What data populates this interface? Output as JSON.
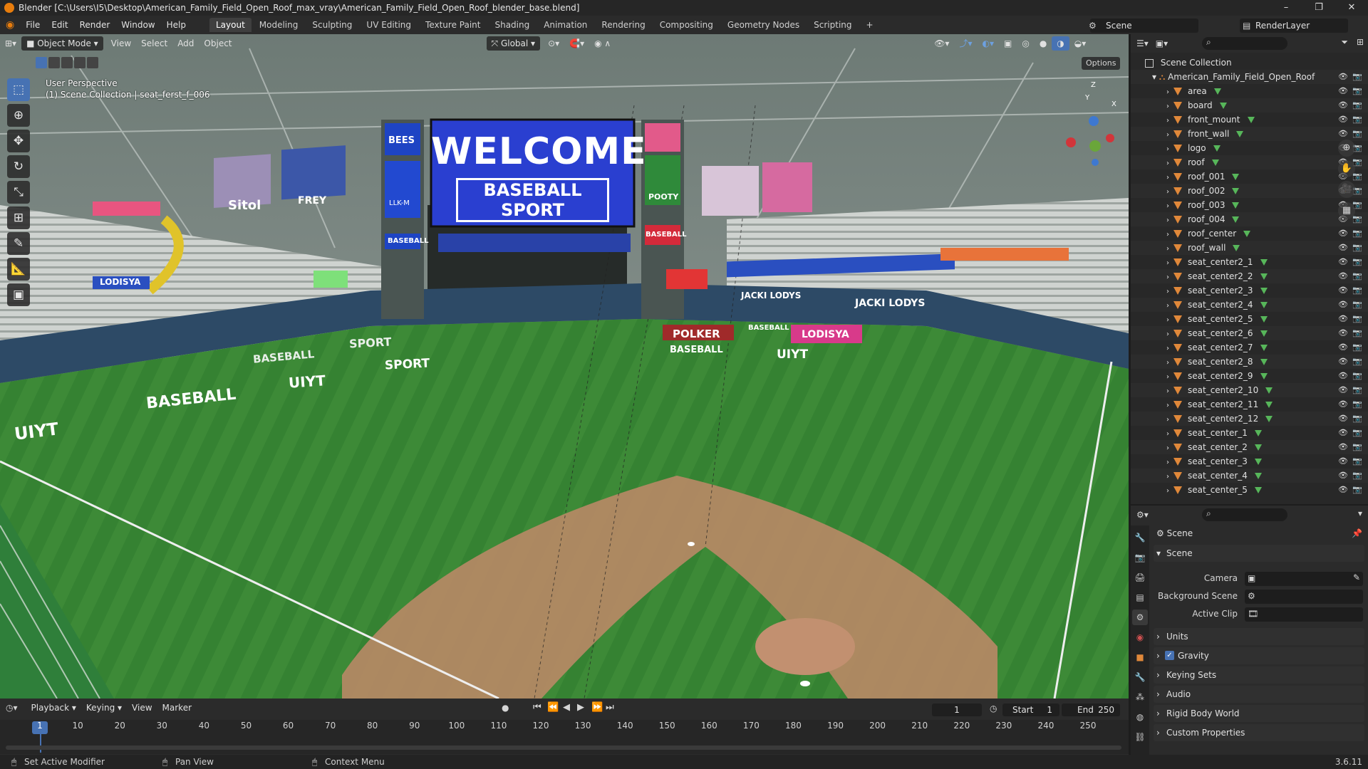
{
  "window": {
    "title": "Blender [C:\\Users\\I5\\Desktop\\American_Family_Field_Open_Roof_max_vray\\American_Family_Field_Open_Roof_blender_base.blend]",
    "minimize": "–",
    "maximize": "❐",
    "close": "✕"
  },
  "menus": [
    "File",
    "Edit",
    "Render",
    "Window",
    "Help"
  ],
  "workspaces": [
    "Layout",
    "Modeling",
    "Sculpting",
    "UV Editing",
    "Texture Paint",
    "Shading",
    "Animation",
    "Rendering",
    "Compositing",
    "Geometry Nodes",
    "Scripting"
  ],
  "workspace_add": "+",
  "scene_name": "Scene",
  "view_layer": "RenderLayer",
  "viewport": {
    "mode": "Object Mode",
    "menus": [
      "View",
      "Select",
      "Add",
      "Object"
    ],
    "transform_orientation": "Global",
    "options": "Options",
    "overlay_line1": "User Perspective",
    "overlay_line2": "(1) Scene Collection | seat_ferst_f_006",
    "gizmo_axes": [
      "Z",
      "Y",
      "X"
    ],
    "billboard": {
      "line1": "WELCOME",
      "line2": "BASEBALL SPORT"
    },
    "signs": [
      "BEES",
      "LLK-M",
      "BASEBALL",
      "POOTY",
      "BASEBALL",
      "Sitol",
      "FREY",
      "LODISYA",
      "SPORT",
      "BASEBALL",
      "UIYT",
      "SPORT",
      "BASEBALL",
      "UIYT",
      "POLKER",
      "BASEBALL",
      "LODISYA",
      "UIYT",
      "JACKI LODYS",
      "JACKI LODYS",
      "BASEBALL"
    ]
  },
  "outliner": {
    "root": "Scene Collection",
    "collection": "American_Family_Field_Open_Roof",
    "objects": [
      "area",
      "board",
      "front_mount",
      "front_wall",
      "logo",
      "roof",
      "roof_001",
      "roof_002",
      "roof_003",
      "roof_004",
      "roof_center",
      "roof_wall",
      "seat_center2_1",
      "seat_center2_2",
      "seat_center2_3",
      "seat_center2_4",
      "seat_center2_5",
      "seat_center2_6",
      "seat_center2_7",
      "seat_center2_8",
      "seat_center2_9",
      "seat_center2_10",
      "seat_center2_11",
      "seat_center2_12",
      "seat_center_1",
      "seat_center_2",
      "seat_center_3",
      "seat_center_4",
      "seat_center_5"
    ]
  },
  "properties": {
    "context": "Scene",
    "panel": "Scene",
    "fields": {
      "camera": "Camera",
      "background_scene": "Background Scene",
      "active_clip": "Active Clip"
    },
    "subpanels": [
      "Units",
      "Gravity",
      "Keying Sets",
      "Audio",
      "Rigid Body World",
      "Custom Properties"
    ],
    "gravity_checked": true
  },
  "timeline": {
    "menus": [
      "Playback",
      "Keying",
      "View",
      "Marker"
    ],
    "current_frame": "1",
    "start_label": "Start",
    "start": "1",
    "end_label": "End",
    "end": "250",
    "ticks": [
      "1",
      "10",
      "20",
      "30",
      "40",
      "50",
      "60",
      "70",
      "80",
      "90",
      "100",
      "110",
      "120",
      "130",
      "140",
      "150",
      "160",
      "170",
      "180",
      "190",
      "200",
      "210",
      "220",
      "230",
      "240",
      "250"
    ]
  },
  "status": {
    "left": "Set Active Modifier",
    "middle": "Pan View",
    "right": "Context Menu",
    "version": "3.6.11"
  },
  "colors": {
    "accent": "#4772b3",
    "object_icon": "#e0883a",
    "mesh_icon": "#57b65a",
    "billboard_bg": "#2a3fd0"
  }
}
